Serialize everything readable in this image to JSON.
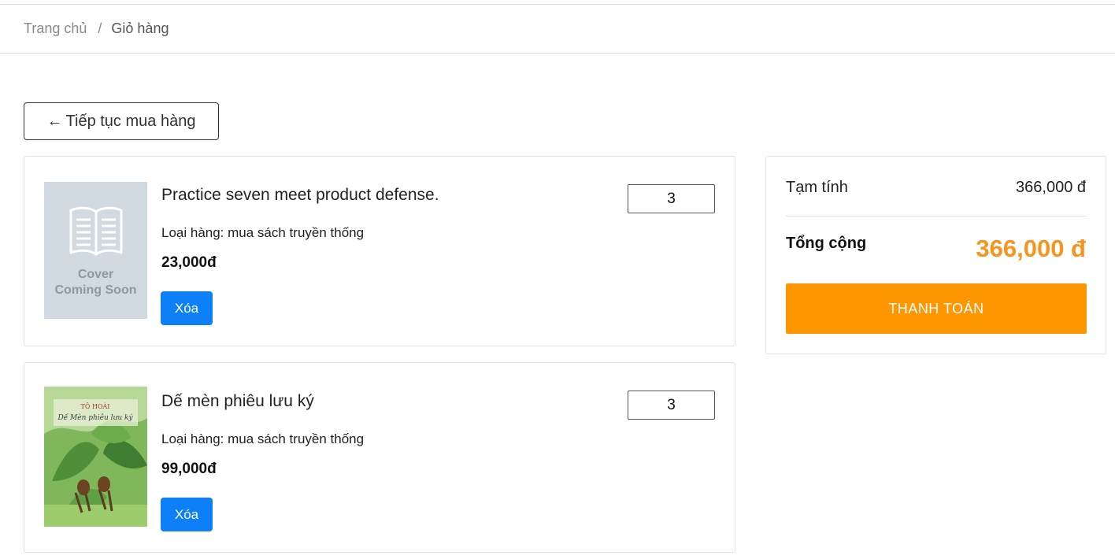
{
  "breadcrumb": {
    "home": "Trang chủ",
    "separator": "/",
    "current": "Giỏ hàng"
  },
  "continue_button": {
    "arrow": "←",
    "label": "Tiếp tục mua hàng"
  },
  "items": [
    {
      "title": "Practice seven meet product defense.",
      "type": "Loại hàng: mua sách truyền thống",
      "price": "23,000đ",
      "quantity": "3",
      "delete_label": "Xóa",
      "cover": {
        "kind": "placeholder",
        "line1": "Cover",
        "line2": "Coming Soon",
        "icon": "open-book-icon"
      }
    },
    {
      "title": "Dế mèn phiêu lưu ký",
      "type": "Loại hàng: mua sách truyền thống",
      "price": "99,000đ",
      "quantity": "3",
      "delete_label": "Xóa",
      "cover": {
        "kind": "artwork",
        "author": "TÔ HOÀI",
        "book_title": "Dế Mèn phiêu lưu ký"
      }
    }
  ],
  "summary": {
    "subtotal_label": "Tạm tính",
    "subtotal_value": "366,000 đ",
    "total_label": "Tổng cộng",
    "total_value": "366,000 đ",
    "checkout_label": "THANH TOÁN"
  },
  "colors": {
    "accent_orange": "#fd9600",
    "total_orange": "#f7941d",
    "delete_blue": "#0d7ff7"
  }
}
